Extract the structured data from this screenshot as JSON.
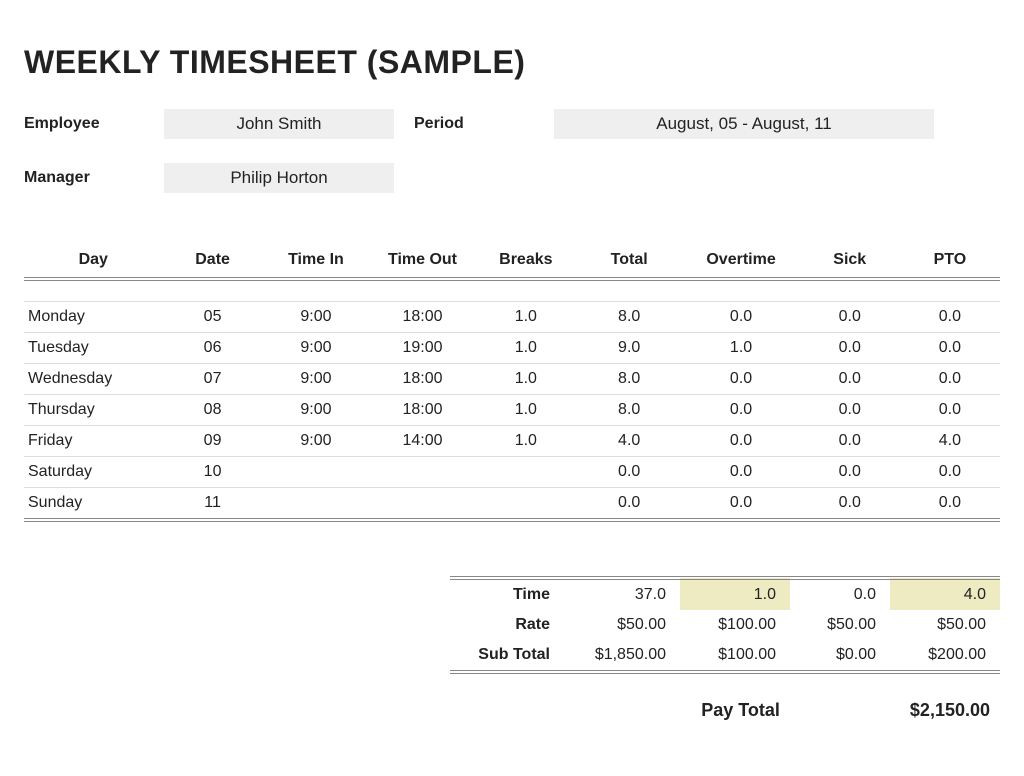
{
  "title": "WEEKLY TIMESHEET (SAMPLE)",
  "labels": {
    "employee": "Employee",
    "manager": "Manager",
    "period": "Period"
  },
  "employee": "John Smith",
  "manager": "Philip Horton",
  "period": "August, 05 - August, 11",
  "columns": {
    "day": "Day",
    "date": "Date",
    "time_in": "Time In",
    "time_out": "Time Out",
    "breaks": "Breaks",
    "total": "Total",
    "overtime": "Overtime",
    "sick": "Sick",
    "pto": "PTO"
  },
  "rows": [
    {
      "day": "Monday",
      "date": "05",
      "in": "9:00",
      "out": "18:00",
      "breaks": "1.0",
      "total": "8.0",
      "ot": "0.0",
      "sick": "0.0",
      "pto": "0.0"
    },
    {
      "day": "Tuesday",
      "date": "06",
      "in": "9:00",
      "out": "19:00",
      "breaks": "1.0",
      "total": "9.0",
      "ot": "1.0",
      "sick": "0.0",
      "pto": "0.0"
    },
    {
      "day": "Wednesday",
      "date": "07",
      "in": "9:00",
      "out": "18:00",
      "breaks": "1.0",
      "total": "8.0",
      "ot": "0.0",
      "sick": "0.0",
      "pto": "0.0"
    },
    {
      "day": "Thursday",
      "date": "08",
      "in": "9:00",
      "out": "18:00",
      "breaks": "1.0",
      "total": "8.0",
      "ot": "0.0",
      "sick": "0.0",
      "pto": "0.0"
    },
    {
      "day": "Friday",
      "date": "09",
      "in": "9:00",
      "out": "14:00",
      "breaks": "1.0",
      "total": "4.0",
      "ot": "0.0",
      "sick": "0.0",
      "pto": "4.0"
    },
    {
      "day": "Saturday",
      "date": "10",
      "in": "",
      "out": "",
      "breaks": "",
      "total": "0.0",
      "ot": "0.0",
      "sick": "0.0",
      "pto": "0.0"
    },
    {
      "day": "Sunday",
      "date": "11",
      "in": "",
      "out": "",
      "breaks": "",
      "total": "0.0",
      "ot": "0.0",
      "sick": "0.0",
      "pto": "0.0"
    }
  ],
  "summary": {
    "labels": {
      "time": "Time",
      "rate": "Rate",
      "sub_total": "Sub Total",
      "pay_total": "Pay Total"
    },
    "time": {
      "total": "37.0",
      "ot": "1.0",
      "sick": "0.0",
      "pto": "4.0"
    },
    "rate": {
      "total": "$50.00",
      "ot": "$100.00",
      "sick": "$50.00",
      "pto": "$50.00"
    },
    "sub_total": {
      "total": "$1,850.00",
      "ot": "$100.00",
      "sick": "$0.00",
      "pto": "$200.00"
    },
    "pay_total": "$2,150.00"
  }
}
